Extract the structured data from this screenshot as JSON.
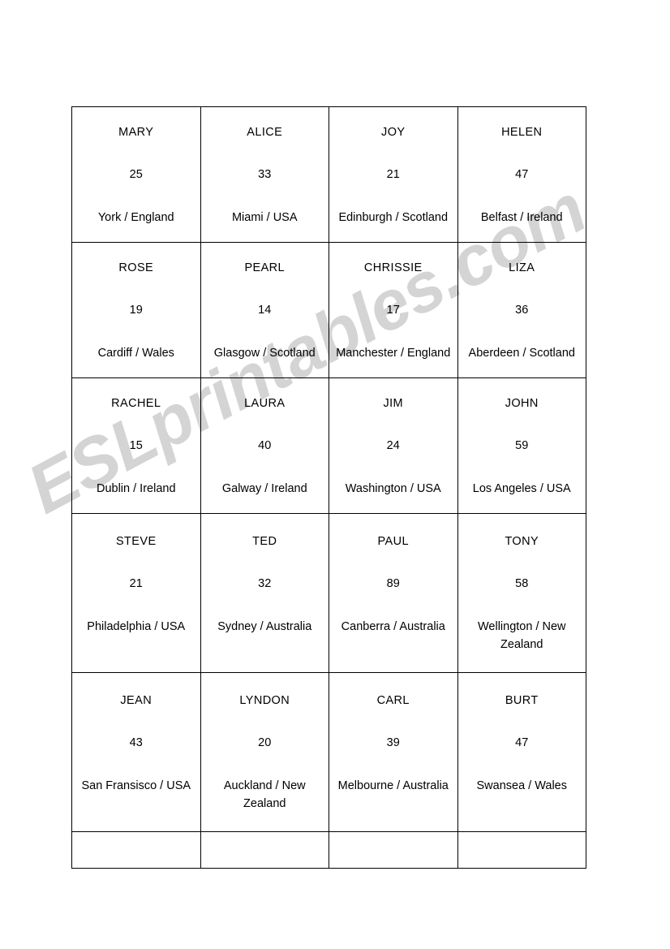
{
  "watermark": {
    "text": "ESLprintables.com",
    "color": "#bfbfbf"
  },
  "worksheet": {
    "columns": 4,
    "rows": 6,
    "cards": [
      {
        "name": "MARY",
        "age": "25",
        "place": "York / England"
      },
      {
        "name": "ALICE",
        "age": "33",
        "place": "Miami / USA"
      },
      {
        "name": "JOY",
        "age": "21",
        "place": "Edinburgh / Scotland"
      },
      {
        "name": "HELEN",
        "age": "47",
        "place": "Belfast / Ireland"
      },
      {
        "name": "ROSE",
        "age": "19",
        "place": "Cardiff / Wales"
      },
      {
        "name": "PEARL",
        "age": "14",
        "place": "Glasgow / Scotland"
      },
      {
        "name": "CHRISSIE",
        "age": "17",
        "place": "Manchester / England"
      },
      {
        "name": "LIZA",
        "age": "36",
        "place": "Aberdeen / Scotland"
      },
      {
        "name": "RACHEL",
        "age": "15",
        "place": "Dublin / Ireland"
      },
      {
        "name": "LAURA",
        "age": "40",
        "place": "Galway / Ireland"
      },
      {
        "name": "JIM",
        "age": "24",
        "place": "Washington / USA"
      },
      {
        "name": "JOHN",
        "age": "59",
        "place": "Los Angeles / USA"
      },
      {
        "name": "STEVE",
        "age": "21",
        "place": "Philadelphia / USA"
      },
      {
        "name": "TED",
        "age": "32",
        "place": "Sydney / Australia"
      },
      {
        "name": "PAUL",
        "age": "89",
        "place": "Canberra / Australia"
      },
      {
        "name": "TONY",
        "age": "58",
        "place": "Wellington / New Zealand"
      },
      {
        "name": "JEAN",
        "age": "43",
        "place": "San Fransisco / USA"
      },
      {
        "name": "LYNDON",
        "age": "20",
        "place": "Auckland / New Zealand"
      },
      {
        "name": "CARL",
        "age": "39",
        "place": "Melbourne / Australia"
      },
      {
        "name": "BURT",
        "age": "47",
        "place": "Swansea / Wales"
      }
    ]
  }
}
